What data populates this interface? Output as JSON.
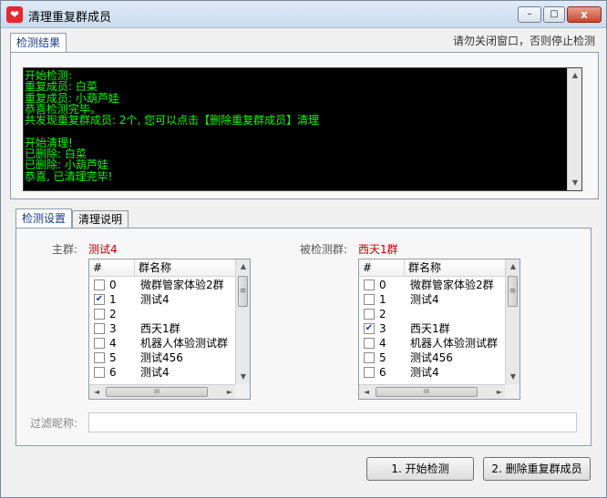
{
  "window": {
    "title": "清理重复群成员",
    "close_glyph": "x",
    "min_glyph": "–",
    "max_glyph": "□"
  },
  "top_tabs": [
    {
      "label": "检测结果"
    }
  ],
  "notice": "请勿关闭窗口，否则停止检测",
  "console": {
    "lines": [
      "开始检测:",
      "重复成员: 白菜",
      "重复成员: 小葫芦娃",
      "恭喜检测完毕。",
      "共发现重复群成员: 2个, 您可以点击【删除重复群成员】清理",
      "",
      "开始清理!",
      "已删除: 白菜",
      "已删除: 小葫芦娃",
      "恭喜, 已清理完毕!"
    ]
  },
  "settings_tabs": [
    {
      "label": "检测设置"
    },
    {
      "label": "清理说明"
    }
  ],
  "main_group": {
    "label": "主群:",
    "value": "测试4",
    "header_index": "#",
    "header_name": "群名称",
    "rows": [
      {
        "index": "0",
        "name": "微群管家体验2群",
        "checked": false
      },
      {
        "index": "1",
        "name": "测试4",
        "checked": true
      },
      {
        "index": "2",
        "name": "",
        "checked": false
      },
      {
        "index": "3",
        "name": "西天1群",
        "checked": false
      },
      {
        "index": "4",
        "name": "机器人体验测试群",
        "checked": false
      },
      {
        "index": "5",
        "name": "测试456",
        "checked": false
      },
      {
        "index": "6",
        "name": "测试4",
        "checked": false
      }
    ]
  },
  "checked_group": {
    "label": "被检测群:",
    "value": "西天1群",
    "header_index": "#",
    "header_name": "群名称",
    "rows": [
      {
        "index": "0",
        "name": "微群管家体验2群",
        "checked": false
      },
      {
        "index": "1",
        "name": "测试4",
        "checked": false
      },
      {
        "index": "2",
        "name": "",
        "checked": false
      },
      {
        "index": "3",
        "name": "西天1群",
        "checked": true
      },
      {
        "index": "4",
        "name": "机器人体验测试群",
        "checked": false
      },
      {
        "index": "5",
        "name": "测试456",
        "checked": false
      },
      {
        "index": "6",
        "name": "测试4",
        "checked": false
      }
    ]
  },
  "filter": {
    "label": "过滤昵称:",
    "value": ""
  },
  "buttons": {
    "start": "1. 开始检测",
    "delete": "2. 删除重复群成员"
  },
  "scroll_glyphs": {
    "up": "▲",
    "down": "▼",
    "left": "◄",
    "right": "►",
    "grip_h": "III",
    "grip_v": "≡"
  },
  "check_glyph": "✔"
}
